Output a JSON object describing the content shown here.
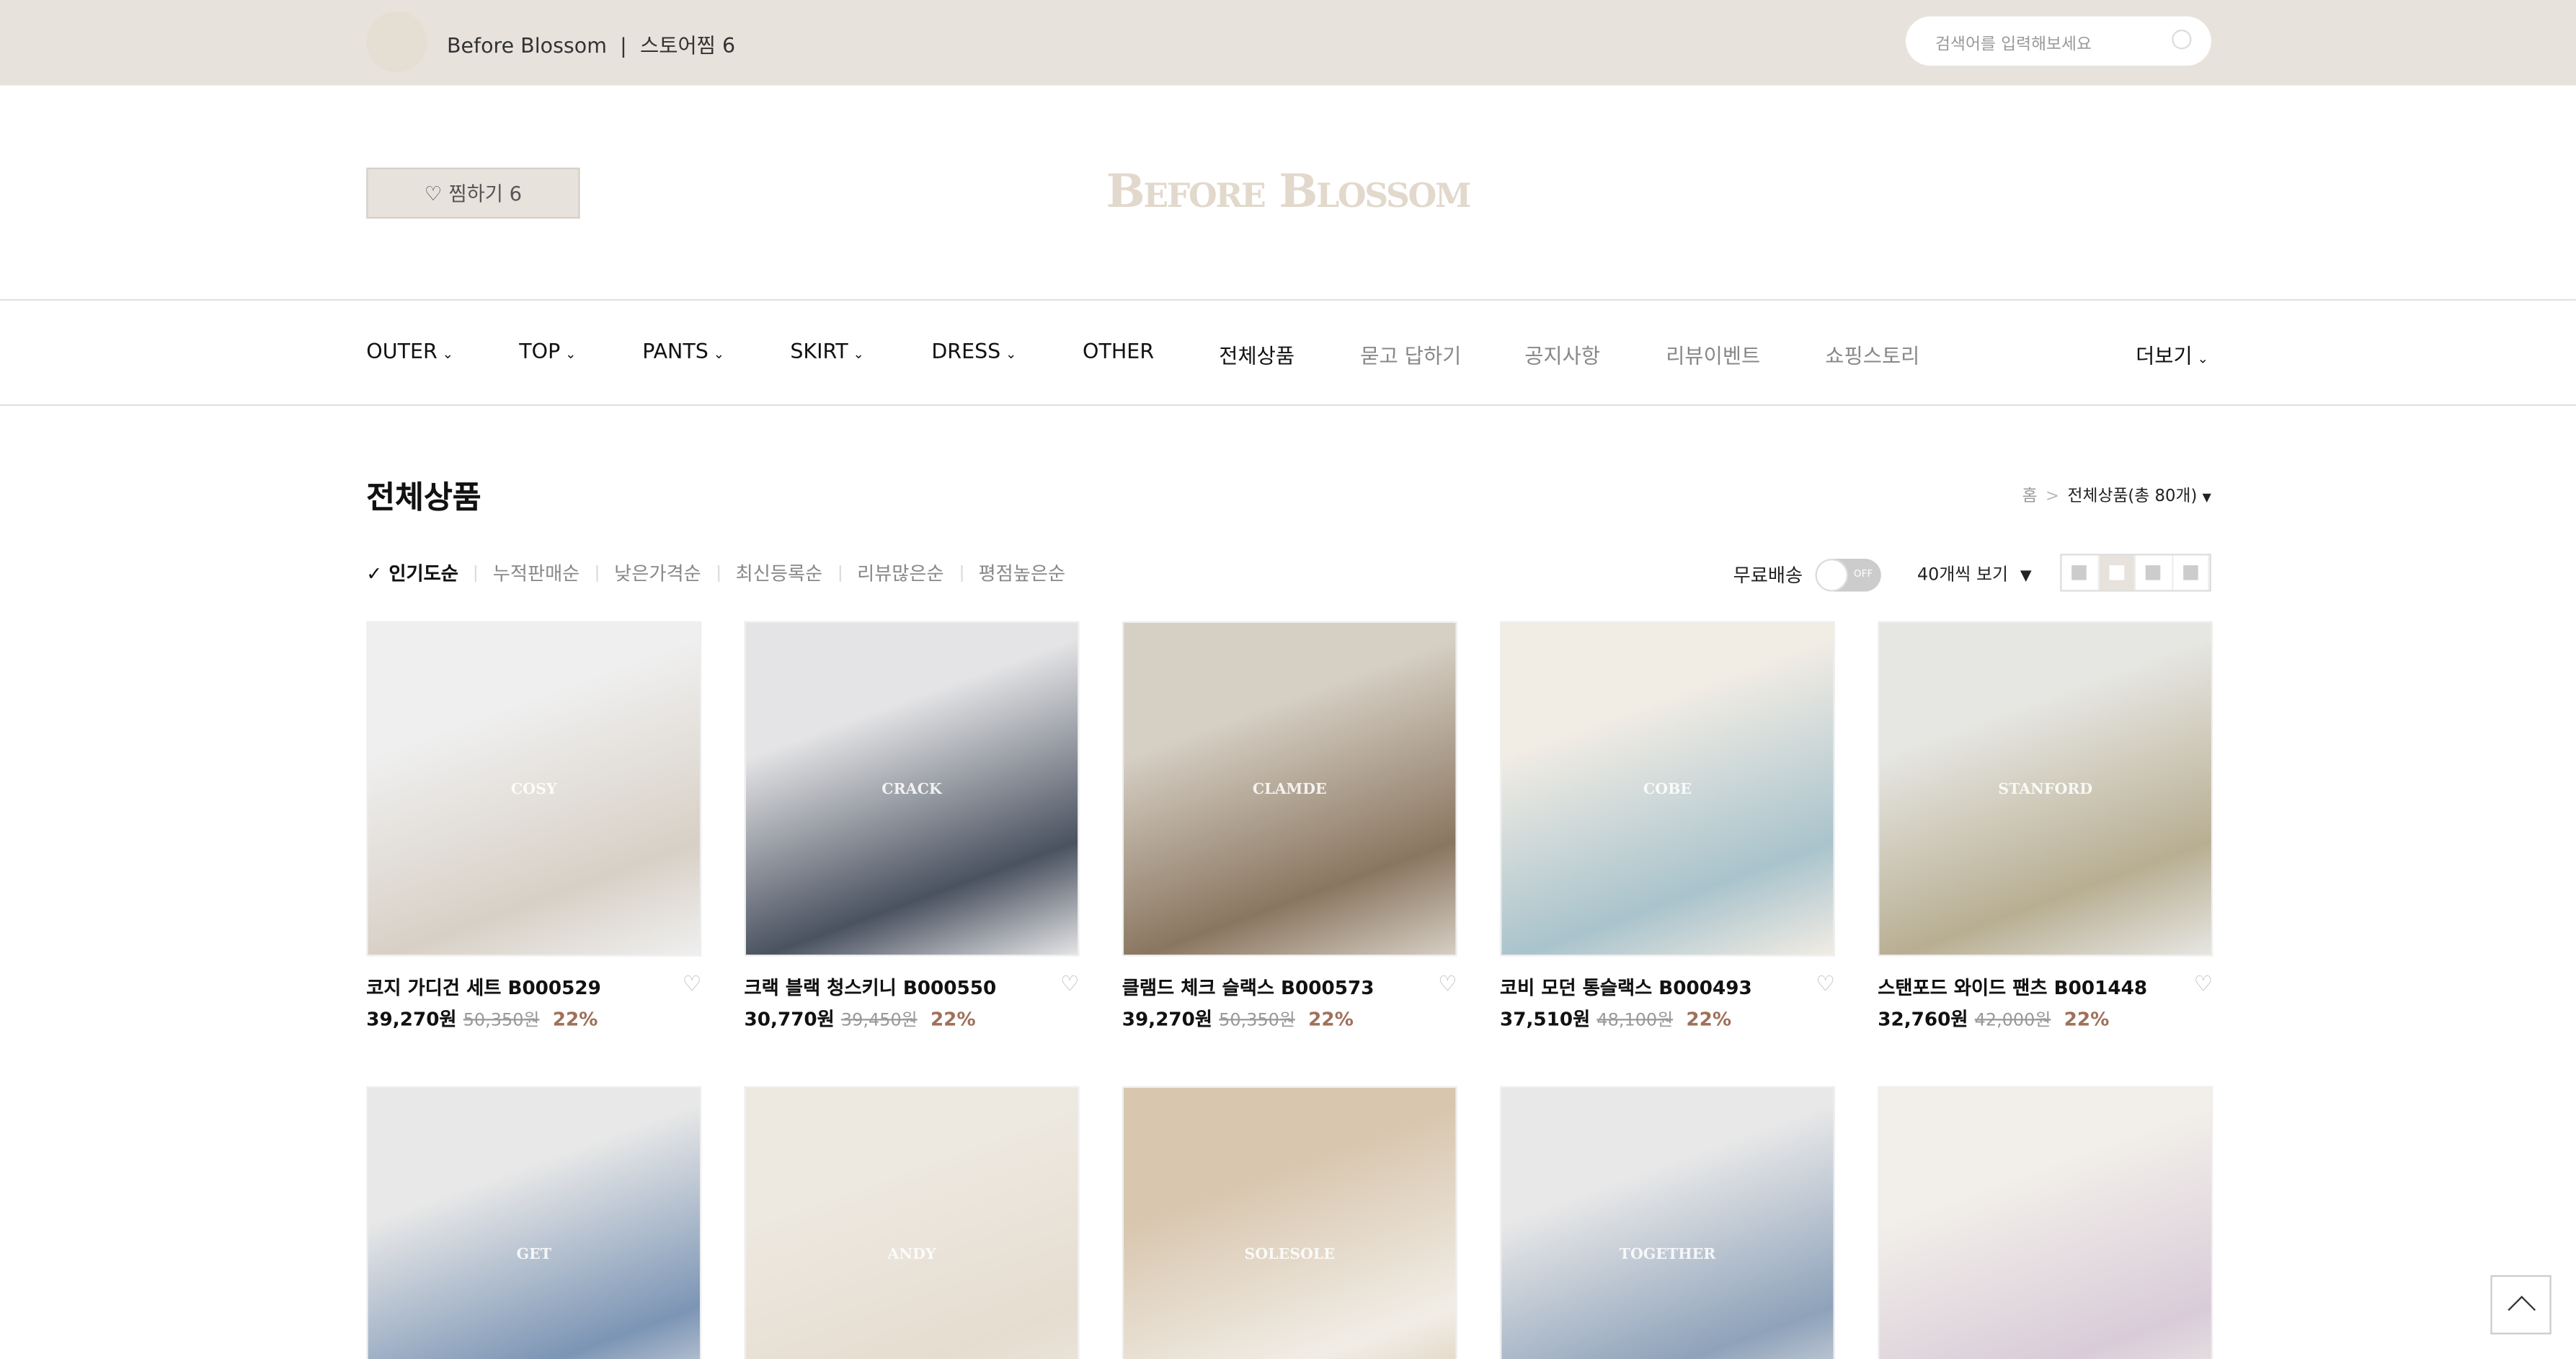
{
  "topbar": {
    "store_name": "Before Blossom",
    "store_wish": "스토어찜 6",
    "search_placeholder": "검색어를 입력해보세요"
  },
  "header": {
    "wish_button": "찜하기 6",
    "logo": "Before Blossom"
  },
  "nav": [
    {
      "label": "OUTER",
      "dropdown": true
    },
    {
      "label": "TOP",
      "dropdown": true
    },
    {
      "label": "PANTS",
      "dropdown": true
    },
    {
      "label": "SKIRT",
      "dropdown": true
    },
    {
      "label": "DRESS",
      "dropdown": true
    },
    {
      "label": "OTHER"
    },
    {
      "label": "전체상품"
    },
    {
      "label": "묻고 답하기"
    },
    {
      "label": "공지사항"
    },
    {
      "label": "리뷰이벤트"
    },
    {
      "label": "쇼핑스토리"
    },
    {
      "label": "더보기",
      "dropdown": true
    }
  ],
  "page": {
    "title": "전체상품",
    "breadcrumb_home": "홈",
    "breadcrumb_current": "전체상품(총 80개)"
  },
  "sort": {
    "options": [
      "인기도순",
      "누적판매순",
      "낮은가격순",
      "최신등록순",
      "리뷰많은순",
      "평점높은순"
    ],
    "selected": "인기도순"
  },
  "filters": {
    "free_shipping": "무료배송",
    "toggle_state": "OFF",
    "per_page": "40개씩 보기",
    "view_mode_selected": 2
  },
  "products": [
    {
      "name": "코지 가디건 세트 B000529",
      "price": "39,270원",
      "original": "50,350원",
      "discount": "22%",
      "image_label": "COSY",
      "colors": [
        "#efefef",
        "#d8d0c6"
      ]
    },
    {
      "name": "크랙 블랙 청스키니 B000550",
      "price": "30,770원",
      "original": "39,450원",
      "discount": "22%",
      "image_label": "CRACK",
      "colors": [
        "#e4e4e6",
        "#4a5260"
      ]
    },
    {
      "name": "클램드 체크 슬랙스 B000573",
      "price": "39,270원",
      "original": "50,350원",
      "discount": "22%",
      "image_label": "CLAMDE",
      "colors": [
        "#d6cfc4",
        "#8a7660"
      ]
    },
    {
      "name": "코비 모던 통슬랙스 B000493",
      "price": "37,510원",
      "original": "48,100원",
      "discount": "22%",
      "image_label": "COBE",
      "colors": [
        "#f1ece4",
        "#a9c3cc"
      ]
    },
    {
      "name": "스탠포드 와이드 팬츠 B001448",
      "price": "32,760원",
      "original": "42,000원",
      "discount": "22%",
      "image_label": "STANFORD",
      "colors": [
        "#e6e6e2",
        "#b8ae92"
      ]
    },
    {
      "image_label": "GET",
      "colors": [
        "#e8e8e8",
        "#7c95b5"
      ]
    },
    {
      "image_label": "ANDY",
      "colors": [
        "#ede8e0",
        "#e6ddd0"
      ]
    },
    {
      "image_label": "SOLESOLE",
      "colors": [
        "#d8c6ae",
        "#f1ede6"
      ]
    },
    {
      "image_label": "TOGETHER",
      "colors": [
        "#e8e8e8",
        "#8ea2ba"
      ]
    },
    {
      "image_label": "",
      "colors": [
        "#f2efea",
        "#d9ccd8"
      ]
    }
  ]
}
